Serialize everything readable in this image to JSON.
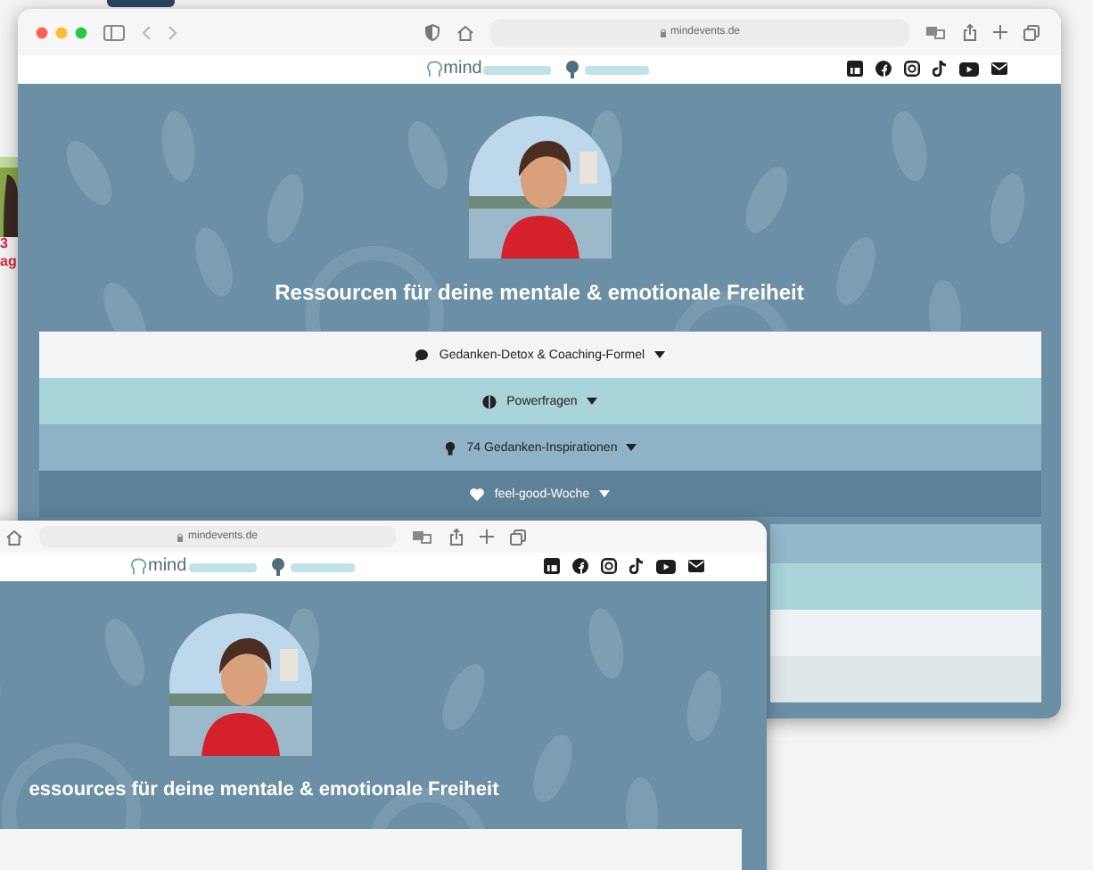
{
  "back_page": {
    "texts": [
      "3",
      "ag"
    ]
  },
  "windows": [
    {
      "url": "mindevents.de",
      "logo": "mind",
      "heading": "Ressourcen für deine mentale & emotionale Freiheit",
      "menu": [
        {
          "kind": "chat",
          "label": "Gedanken-Detox & Coaching-Formel",
          "color": "#f2f4f5"
        },
        {
          "kind": "brain",
          "label": "Powerfragen",
          "color": "#a9d4da"
        },
        {
          "kind": "bulb",
          "label": "74 Gedanken-Inspirationen",
          "color": "#8fb3c6"
        },
        {
          "kind": "heart",
          "label": "feel-good-Woche",
          "color": "#5d8298"
        }
      ]
    },
    {
      "url": "mindevents.de",
      "logo": "mind",
      "heading": "essources für deine mentale & emotionale Freiheit"
    }
  ]
}
